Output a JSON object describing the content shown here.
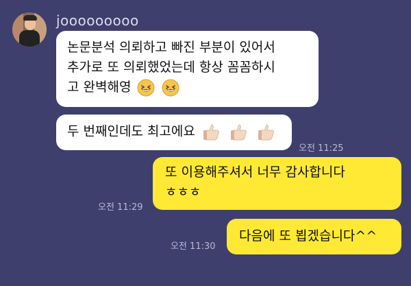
{
  "user": {
    "name": "jooooooooo",
    "avatar_icon": "profile-avatar"
  },
  "messages": [
    {
      "sender": "other",
      "lines": [
        "논문분석 의뢰하고 빠진 부분이 있어서",
        "추가로 또 의뢰했었는데 항상 꼼꼼하시",
        "고 완벽해영"
      ],
      "emoji": "laughing-emoji"
    },
    {
      "sender": "other",
      "text": "두 번째인데도 최고에요",
      "emoji": "thumbs-up-emoji",
      "time": "오전 11:25"
    },
    {
      "sender": "self",
      "lines": [
        "또 이용해주셔서 너무 감사합니다",
        "ㅎㅎㅎ"
      ],
      "time": "오전 11:29"
    },
    {
      "sender": "self",
      "text": "다음에 또 뵙겠습니다^^",
      "time": "오전 11:30"
    }
  ],
  "colors": {
    "background": "#3f3f6e",
    "incoming_bubble": "#ffffff",
    "outgoing_bubble": "#ffe934"
  }
}
